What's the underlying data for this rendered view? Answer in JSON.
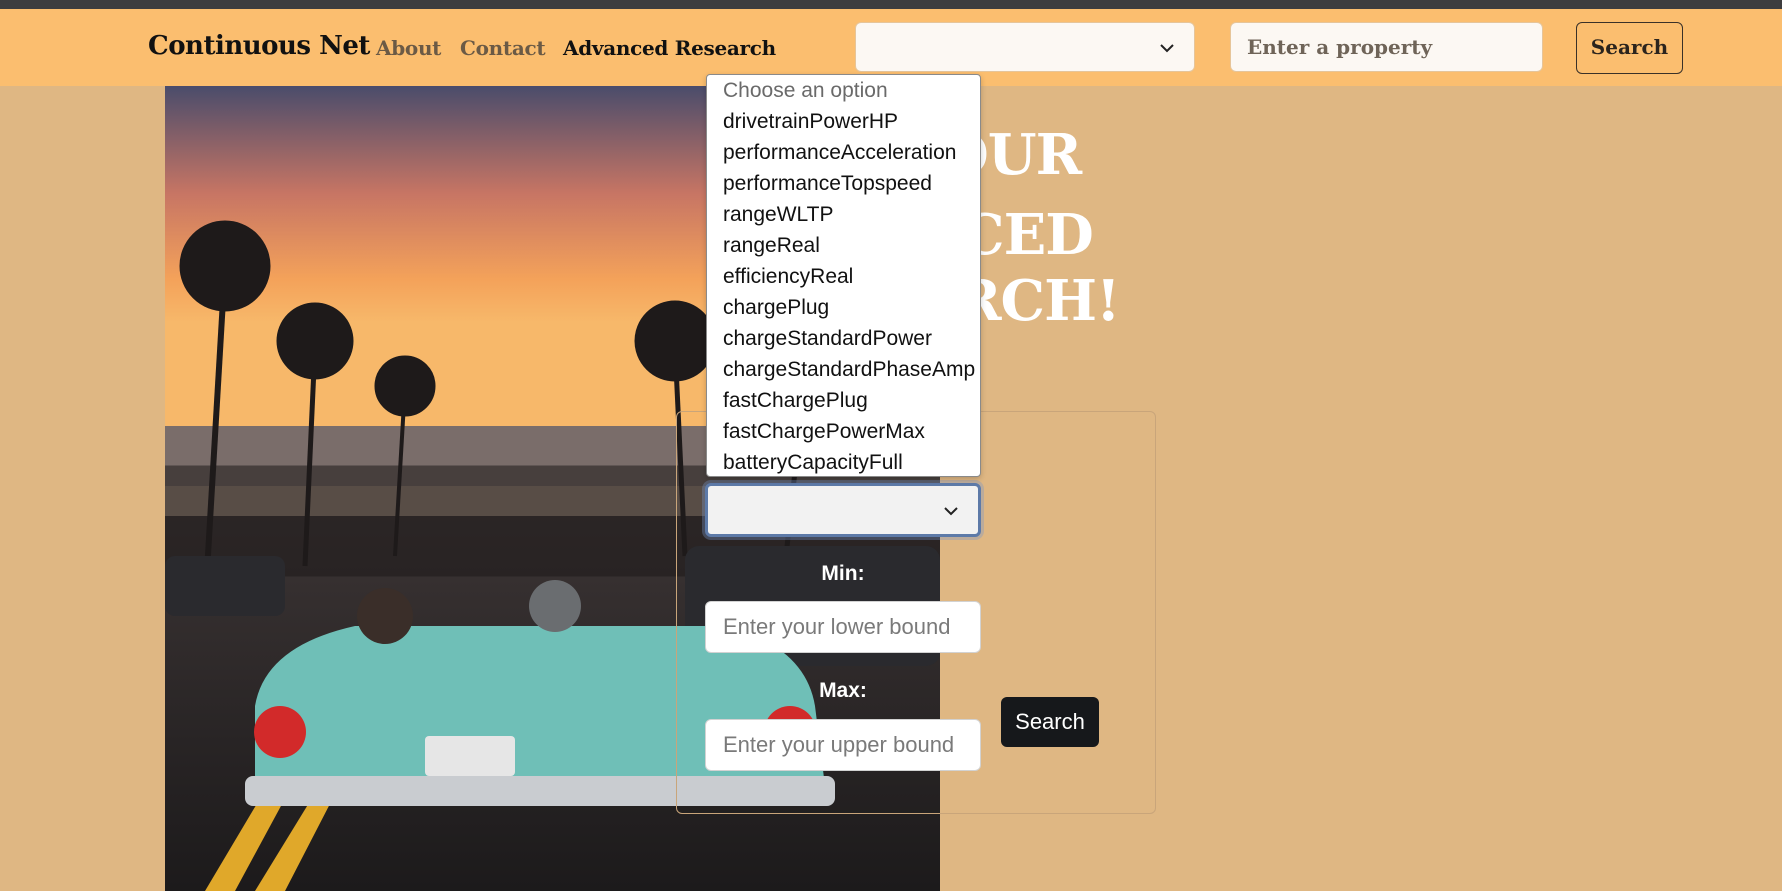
{
  "navbar": {
    "brand": "Continuous Net",
    "links": [
      {
        "label": "About"
      },
      {
        "label": "Contact"
      },
      {
        "label": "Advanced Research"
      }
    ],
    "property_select_value": "",
    "search_placeholder": "Enter a property",
    "search_button": "Search"
  },
  "hero": {
    "heading_line1": "OUR",
    "heading_line2": "CED",
    "heading_line3": "RCH!"
  },
  "form": {
    "field_select_value": "",
    "min_label": "Min:",
    "min_placeholder": "Enter your lower bound",
    "max_label": "Max:",
    "max_placeholder": "Enter your upper bound",
    "search_button": "Search"
  },
  "dropdown": {
    "placeholder": "Choose an option",
    "options": [
      "drivetrainPowerHP",
      "performanceAcceleration",
      "performanceTopspeed",
      "rangeWLTP",
      "rangeReal",
      "efficiencyReal",
      "chargePlug",
      "chargeStandardPower",
      "chargeStandardPhaseAmp",
      "fastChargePlug",
      "fastChargePowerMax",
      "batteryCapacityFull"
    ]
  }
}
